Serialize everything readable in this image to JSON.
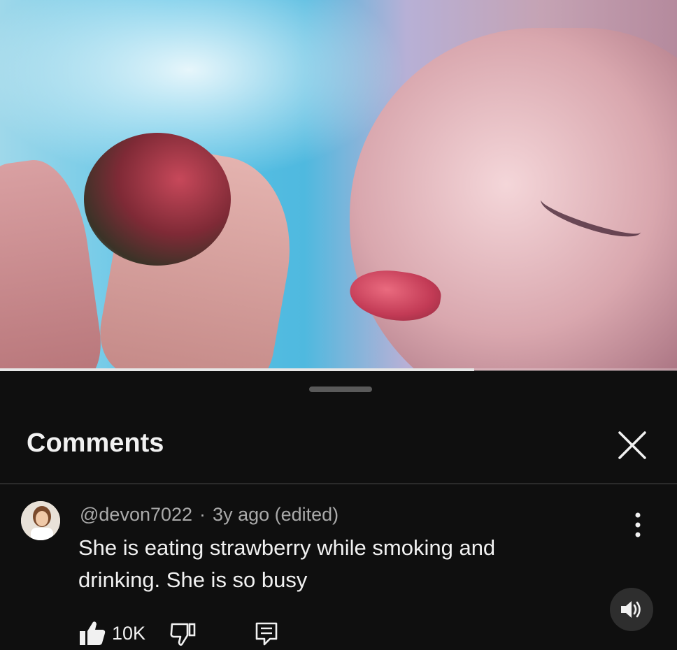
{
  "video": {
    "progress_fraction": 0.7
  },
  "comments_panel": {
    "title": "Comments",
    "close_icon": "close-icon"
  },
  "comment": {
    "author": "@devon7022",
    "separator": "·",
    "time": "3y ago (edited)",
    "text": "She is eating strawberry while smoking and drinking. She is so busy",
    "like_count": "10K",
    "icons": [
      "thumbs-up-icon",
      "thumbs-down-icon",
      "reply-icon",
      "more-vert-icon"
    ]
  },
  "overlay": {
    "volume_icon": "volume-icon"
  },
  "colors": {
    "background": "#0f0f0f",
    "text_primary": "#f1f1f1",
    "text_secondary": "#aaaaaa",
    "divider": "#2b2b2b"
  }
}
